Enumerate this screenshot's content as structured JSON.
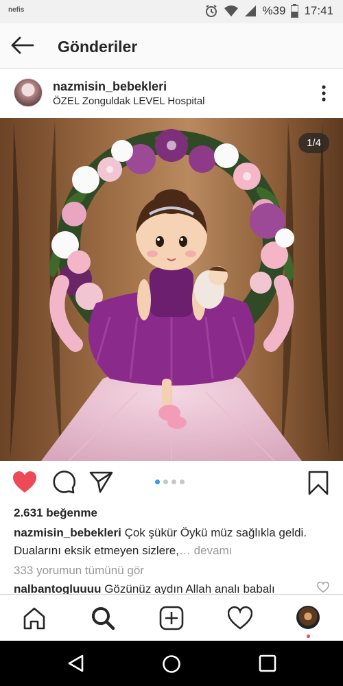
{
  "status_bar": {
    "carrier": "nefis",
    "battery": "%39",
    "time": "17:41"
  },
  "header": {
    "title": "Gönderiler"
  },
  "post": {
    "username": "nazmisin_bebekleri",
    "location": "ÖZEL Zonguldak LEVEL Hospital",
    "counter": "1/4",
    "likes": "2.631 beğenme",
    "caption_user": "nazmisin_bebekleri",
    "caption_text": " Çok şükür Öykü müz sağlıkla geldi. Dualarını eksik etmeyen sizlere,",
    "caption_more": "… devamı",
    "comments_link": "333 yorumun tümünü gör",
    "comment_user": "nalbantogluuuu",
    "comment_text": " Gözünüz aydın Allah analı babalı"
  },
  "carousel": {
    "total": 4,
    "current": 1
  },
  "colors": {
    "accent": "#3897f0",
    "like": "#ed4956",
    "text": "#262626",
    "muted": "#999999"
  },
  "icons": [
    "back-arrow-icon",
    "more-icon",
    "heart-icon",
    "comment-icon",
    "share-icon",
    "bookmark-icon",
    "home-icon",
    "search-icon",
    "add-icon",
    "activity-icon",
    "back-triangle-icon",
    "home-circle-icon",
    "recents-square-icon"
  ]
}
